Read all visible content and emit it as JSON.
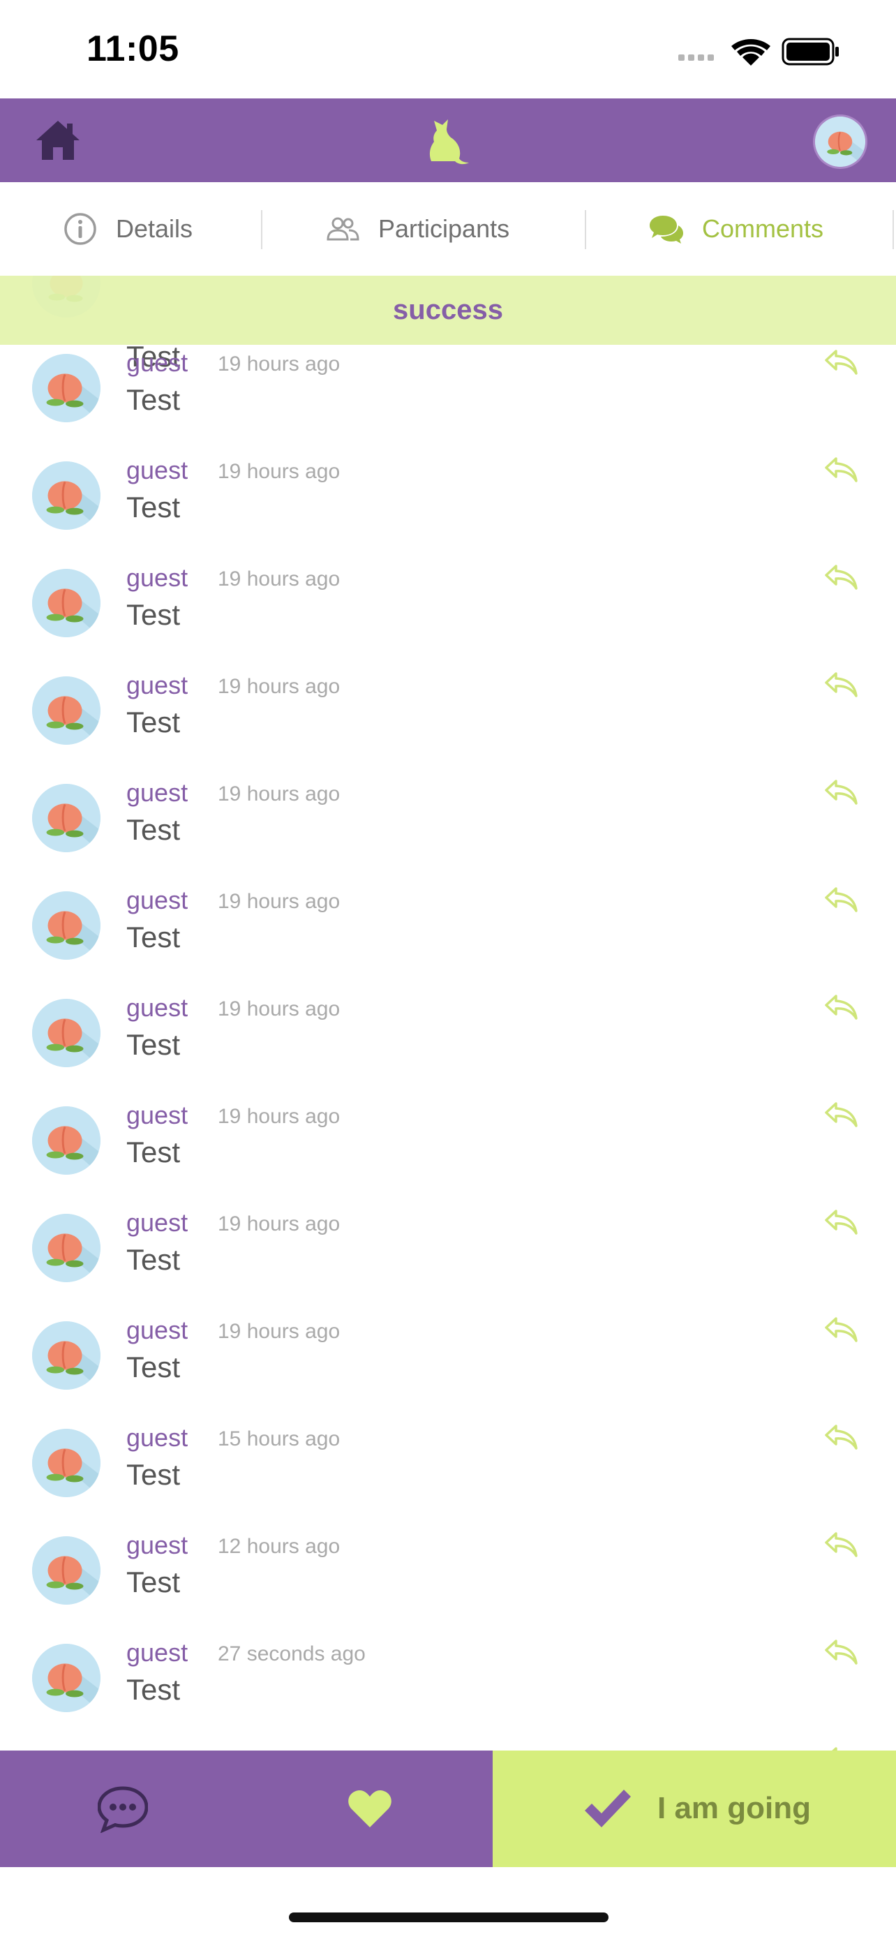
{
  "status_bar": {
    "time": "11:05"
  },
  "header": {
    "home_icon": "home-icon",
    "logo_icon": "cat-logo-icon",
    "avatar_icon": "peach-avatar-icon",
    "color": "#855ea7"
  },
  "tabs": [
    {
      "label": "Details",
      "icon": "info-icon",
      "active": false
    },
    {
      "label": "Participants",
      "icon": "people-icon",
      "active": false
    },
    {
      "label": "Comments",
      "icon": "comments-icon",
      "active": true
    }
  ],
  "toast": {
    "text": "success",
    "background": "#e3f3ac"
  },
  "partial_top_comment": {
    "text": "Test"
  },
  "comments": [
    {
      "author": "guest",
      "time": "19 hours ago",
      "text": "Test"
    },
    {
      "author": "guest",
      "time": "19 hours ago",
      "text": "Test"
    },
    {
      "author": "guest",
      "time": "19 hours ago",
      "text": "Test"
    },
    {
      "author": "guest",
      "time": "19 hours ago",
      "text": "Test"
    },
    {
      "author": "guest",
      "time": "19 hours ago",
      "text": "Test"
    },
    {
      "author": "guest",
      "time": "19 hours ago",
      "text": "Test"
    },
    {
      "author": "guest",
      "time": "19 hours ago",
      "text": "Test"
    },
    {
      "author": "guest",
      "time": "19 hours ago",
      "text": "Test"
    },
    {
      "author": "guest",
      "time": "19 hours ago",
      "text": "Test"
    },
    {
      "author": "guest",
      "time": "19 hours ago",
      "text": "Test"
    },
    {
      "author": "guest",
      "time": "15 hours ago",
      "text": "Test"
    },
    {
      "author": "guest",
      "time": "12 hours ago",
      "text": "Test"
    },
    {
      "author": "guest",
      "time": "27 seconds ago",
      "text": "Test"
    }
  ],
  "bottom_bar": {
    "chat_icon": "chat-bubble-icon",
    "heart_icon": "heart-icon",
    "going_label": "I am going",
    "going_icon": "checkmark-icon",
    "going_color": "#d6ee7d"
  }
}
